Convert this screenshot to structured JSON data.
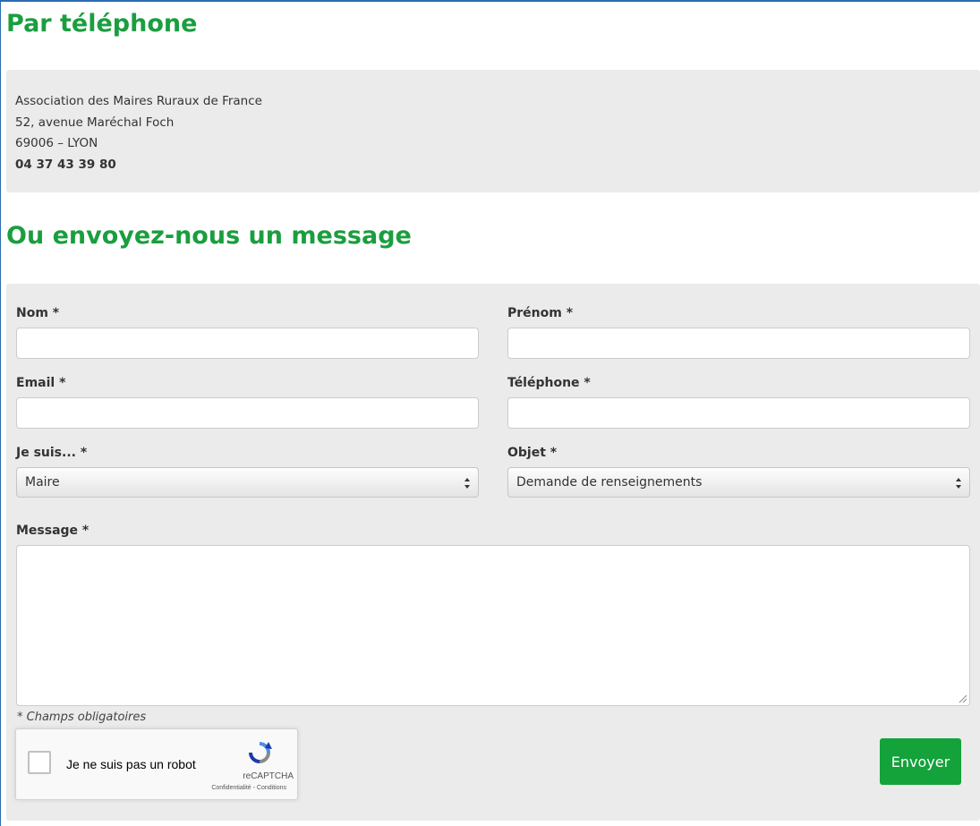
{
  "phone_section": {
    "title": "Par téléphone",
    "address": {
      "line1": "Association des Maires Ruraux de France",
      "line2": "52, avenue Maréchal Foch",
      "line3": "69006 – LYON",
      "phone": "04 37 43 39 80"
    }
  },
  "message_section": {
    "title": "Ou envoyez-nous un message",
    "form": {
      "nom_label": "Nom *",
      "prenom_label": "Prénom *",
      "email_label": "Email *",
      "telephone_label": "Téléphone *",
      "je_suis_label": "Je suis... *",
      "je_suis_value": "Maire",
      "objet_label": "Objet *",
      "objet_value": "Demande de renseignements",
      "message_label": "Message *",
      "required_note": "* Champs obligatoires",
      "submit_label": "Envoyer"
    },
    "captcha": {
      "label": "Je ne suis pas un robot",
      "brand": "reCAPTCHA",
      "links": "Confidentialité - Conditions"
    }
  },
  "colors": {
    "heading_green": "#1a9e3f",
    "button_green": "#14a23b",
    "panel_gray": "#ebebeb"
  }
}
